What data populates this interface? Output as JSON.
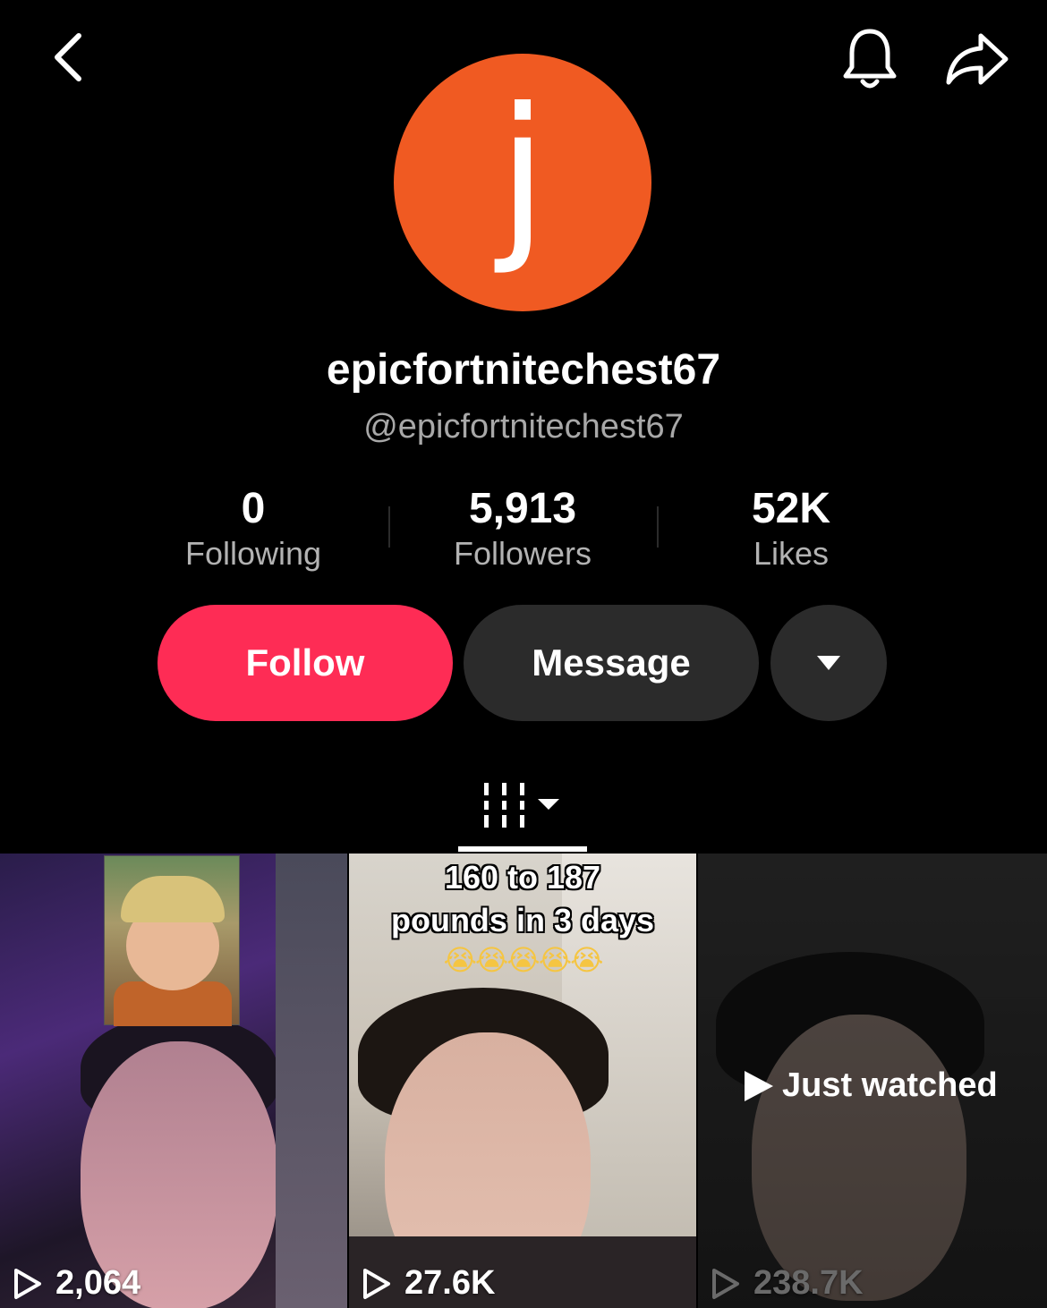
{
  "header": {
    "back_icon": "chevron-left-icon",
    "bell_icon": "bell-icon",
    "share_icon": "share-arrow-icon"
  },
  "profile": {
    "avatar_letter": "j",
    "avatar_color": "#f05a22",
    "display_name": "epicfortnitechest67",
    "handle": "@epicfortnitechest67"
  },
  "stats": [
    {
      "value": "0",
      "label": "Following"
    },
    {
      "value": "5,913",
      "label": "Followers"
    },
    {
      "value": "52K",
      "label": "Likes"
    }
  ],
  "actions": {
    "follow_label": "Follow",
    "follow_color": "#fe2c55",
    "message_label": "Message"
  },
  "tabs": {
    "videos_icon": "grid-icon"
  },
  "videos": [
    {
      "views": "2,064"
    },
    {
      "views": "27.6K",
      "caption_line1": "160 to 187",
      "caption_line2": "pounds in 3 days",
      "emojis": "😭😭😭😭😭"
    },
    {
      "views": "238.7K",
      "badge": "Just watched"
    }
  ]
}
